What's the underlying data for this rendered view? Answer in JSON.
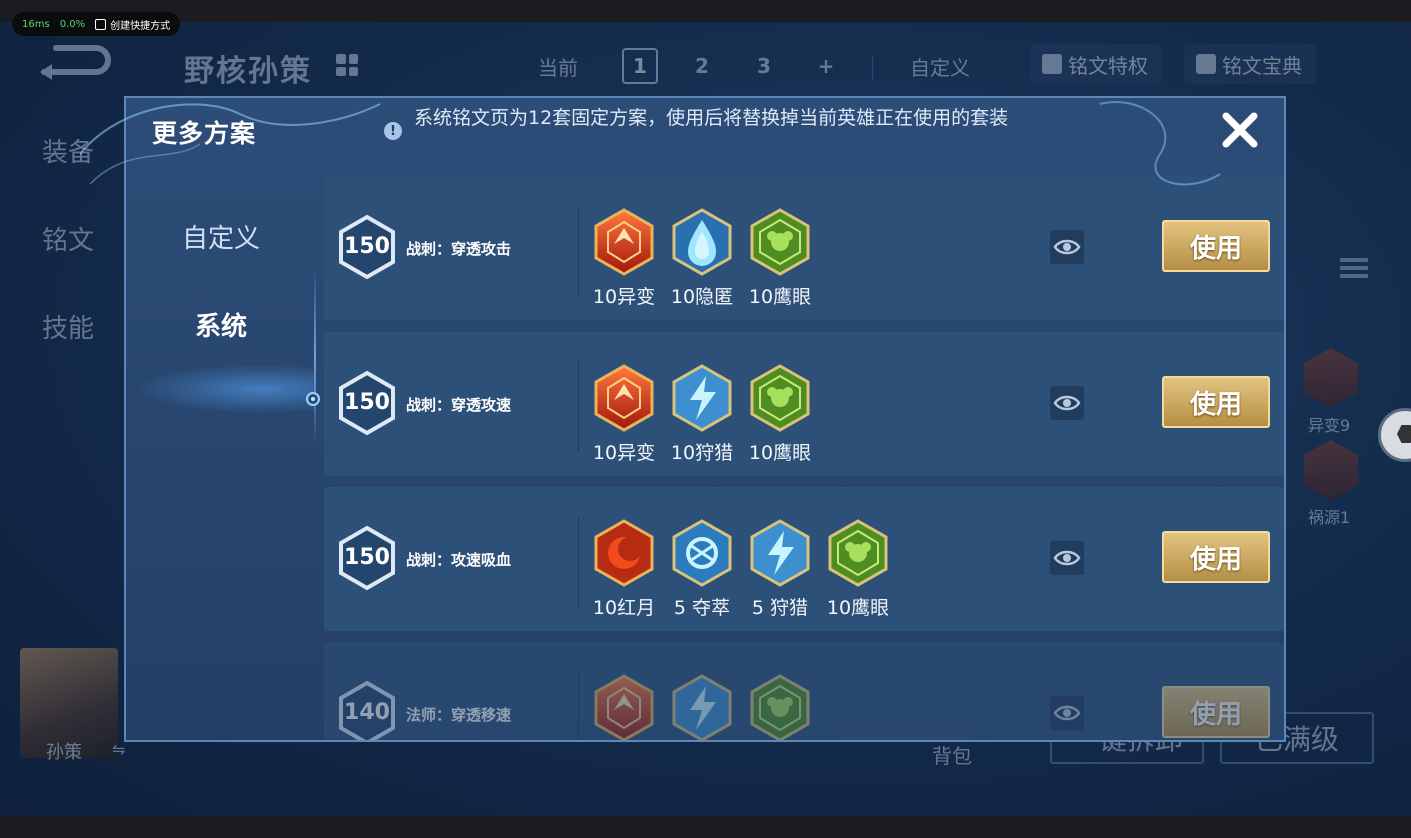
{
  "overlay": {
    "ms": "16ms",
    "cpu": "0.0%",
    "shortcut": "创建快捷方式"
  },
  "background": {
    "hero_name": "野核孙策",
    "current_label": "当前",
    "pages": [
      "1",
      "2",
      "3",
      "+"
    ],
    "custom_label": "自定义",
    "privilege_label": "铭文特权",
    "codex_label": "铭文宝典",
    "side_tabs": [
      "装备",
      "铭文",
      "技能"
    ],
    "hero_avatar_name": "孙策",
    "right_runes": [
      "异变9",
      "祸源1"
    ],
    "bag_label": "背包",
    "one_click_label": "一键拆卸",
    "max_level_label": "已满级"
  },
  "modal": {
    "title": "更多方案",
    "notice": "系统铭文页为12套固定方案，使用后将替换掉当前英雄正在使用的套装",
    "nav": [
      "自定义",
      "系统"
    ],
    "use_label": "使用",
    "presets": [
      {
        "level": "150",
        "name": "战刺：穿透攻击",
        "runes": [
          {
            "label": "10异变",
            "type": "red"
          },
          {
            "label": "10隐匿",
            "type": "blue-drop"
          },
          {
            "label": "10鹰眼",
            "type": "green"
          }
        ]
      },
      {
        "level": "150",
        "name": "战刺：穿透攻速",
        "runes": [
          {
            "label": "10异变",
            "type": "red"
          },
          {
            "label": "10狩猎",
            "type": "blue-bolt"
          },
          {
            "label": "10鹰眼",
            "type": "green"
          }
        ]
      },
      {
        "level": "150",
        "name": "战刺：攻速吸血",
        "runes": [
          {
            "label": "10红月",
            "type": "red-moon"
          },
          {
            "label": "5 夺萃",
            "type": "blue-knot"
          },
          {
            "label": "5 狩猎",
            "type": "blue-bolt"
          },
          {
            "label": "10鹰眼",
            "type": "green"
          }
        ]
      },
      {
        "level": "140",
        "name": "法师：穿透移速",
        "runes": [
          {
            "label": "",
            "type": "red"
          },
          {
            "label": "",
            "type": "blue-bolt"
          },
          {
            "label": "",
            "type": "green"
          }
        ]
      }
    ]
  }
}
